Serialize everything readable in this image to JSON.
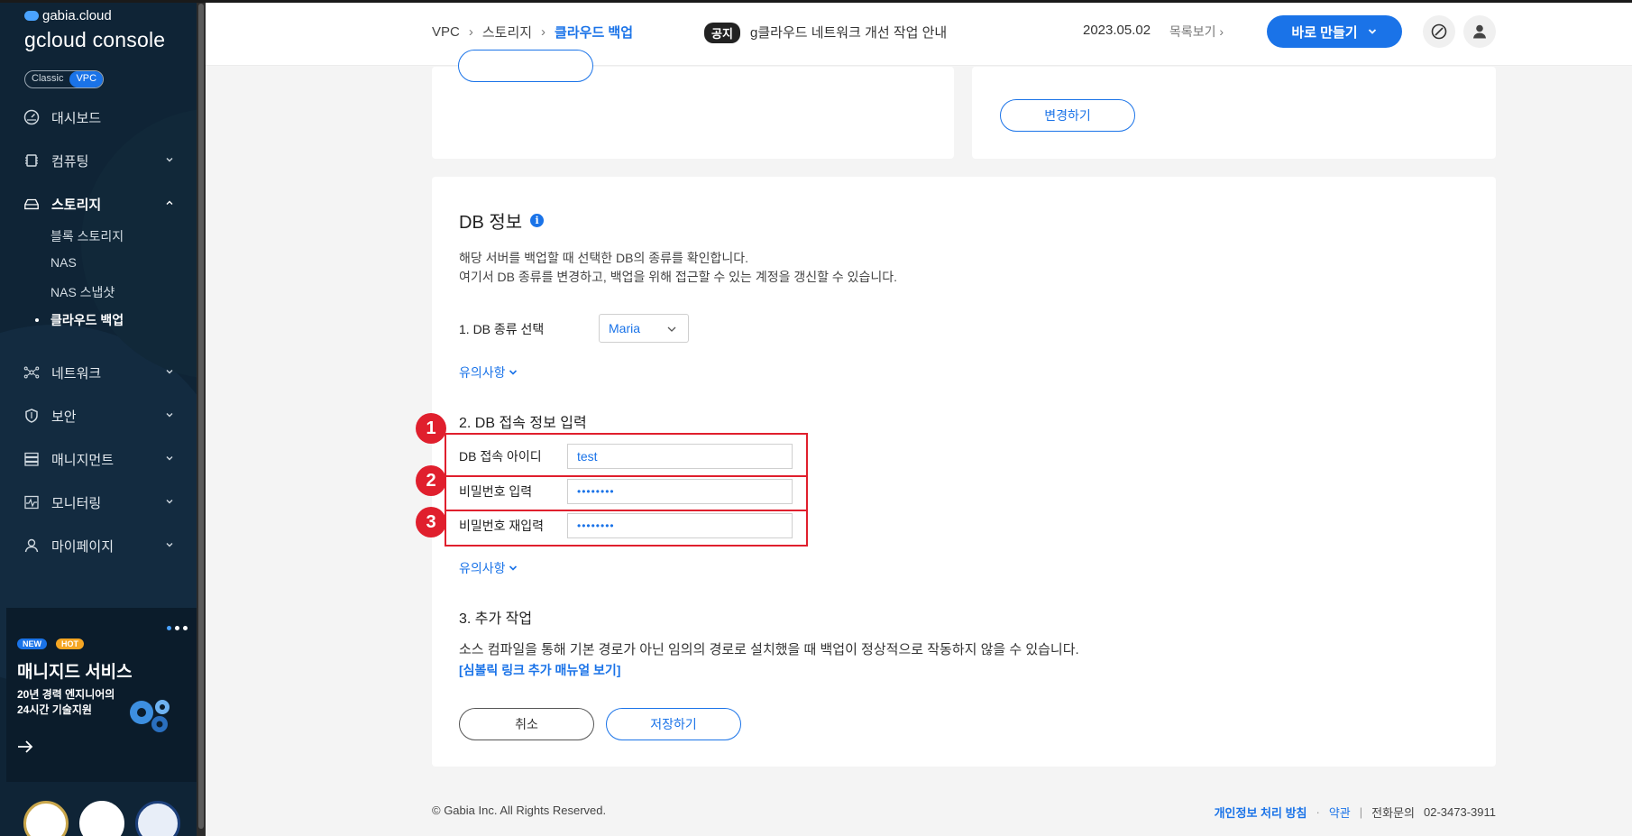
{
  "sidebar": {
    "brand_small": "gabia.cloud",
    "brand_main": "gcloud console",
    "toggle": {
      "classic": "Classic",
      "vpc": "VPC"
    },
    "items": [
      {
        "label": "대시보드",
        "icon": "dashboard-icon"
      },
      {
        "label": "컴퓨팅",
        "icon": "chip-icon"
      },
      {
        "label": "스토리지",
        "icon": "storage-icon",
        "expanded": true
      },
      {
        "label": "네트워크",
        "icon": "network-icon"
      },
      {
        "label": "보안",
        "icon": "shield-icon"
      },
      {
        "label": "매니지먼트",
        "icon": "server-icon"
      },
      {
        "label": "모니터링",
        "icon": "monitor-icon"
      },
      {
        "label": "마이페이지",
        "icon": "user-icon"
      }
    ],
    "storage_sub": [
      "블록 스토리지",
      "NAS",
      "NAS 스냅샷",
      "클라우드 백업"
    ],
    "promo": {
      "badge_new": "NEW",
      "badge_hot": "HOT",
      "title": "매니지드 서비스",
      "subtitle": "20년 경력 엔지니어의 24시간 기술지원"
    }
  },
  "header": {
    "breadcrumb": [
      "VPC",
      "스토리지",
      "클라우드 백업"
    ],
    "notice_tag": "공지",
    "notice_text": "g클라우드 네트워크 개선 작업 안내",
    "notice_date": "2023.05.02",
    "notice_list": "목록보기",
    "create_button": "바로 만들기"
  },
  "top_cards": {
    "change_button": "변경하기"
  },
  "db_info": {
    "title": "DB 정보",
    "desc_line1": "해당 서버를 백업할 때 선택한 DB의 종류를 확인합니다.",
    "desc_line2": "여기서 DB 종류를 변경하고, 백업을 위해 접근할 수 있는 계정을 갱신할 수 있습니다.",
    "step1_label": "1. DB 종류 선택",
    "db_type": "Maria",
    "notice_link": "유의사항",
    "step2_label": "2. DB 접속 정보 입력",
    "id_label": "DB 접속 아이디",
    "id_value": "test",
    "pw_label": "비밀번호 입력",
    "pw_value": "••••••••",
    "pw_confirm_label": "비밀번호 재입력",
    "pw_confirm_value": "••••••••",
    "markers": [
      "1",
      "2",
      "3"
    ],
    "step3_label": "3. 추가 작업",
    "step3_desc": "소스 컴파일을 통해 기본 경로가 아닌 임의의 경로로 설치했을 때 백업이 정상적으로 작동하지 않을 수 있습니다.",
    "manual_link": "[심볼릭 링크 추가 매뉴얼 보기]",
    "cancel_button": "취소",
    "save_button": "저장하기"
  },
  "footer": {
    "copyright": "© Gabia Inc. All Rights Reserved.",
    "privacy": "개인정보 처리 방침",
    "terms": "약관",
    "phone_label": "전화문의",
    "phone": "02-3473-3911"
  },
  "colors": {
    "accent": "#1a73e8",
    "sidebar_bg": "#0f2436",
    "highlight": "#e01f2d"
  }
}
